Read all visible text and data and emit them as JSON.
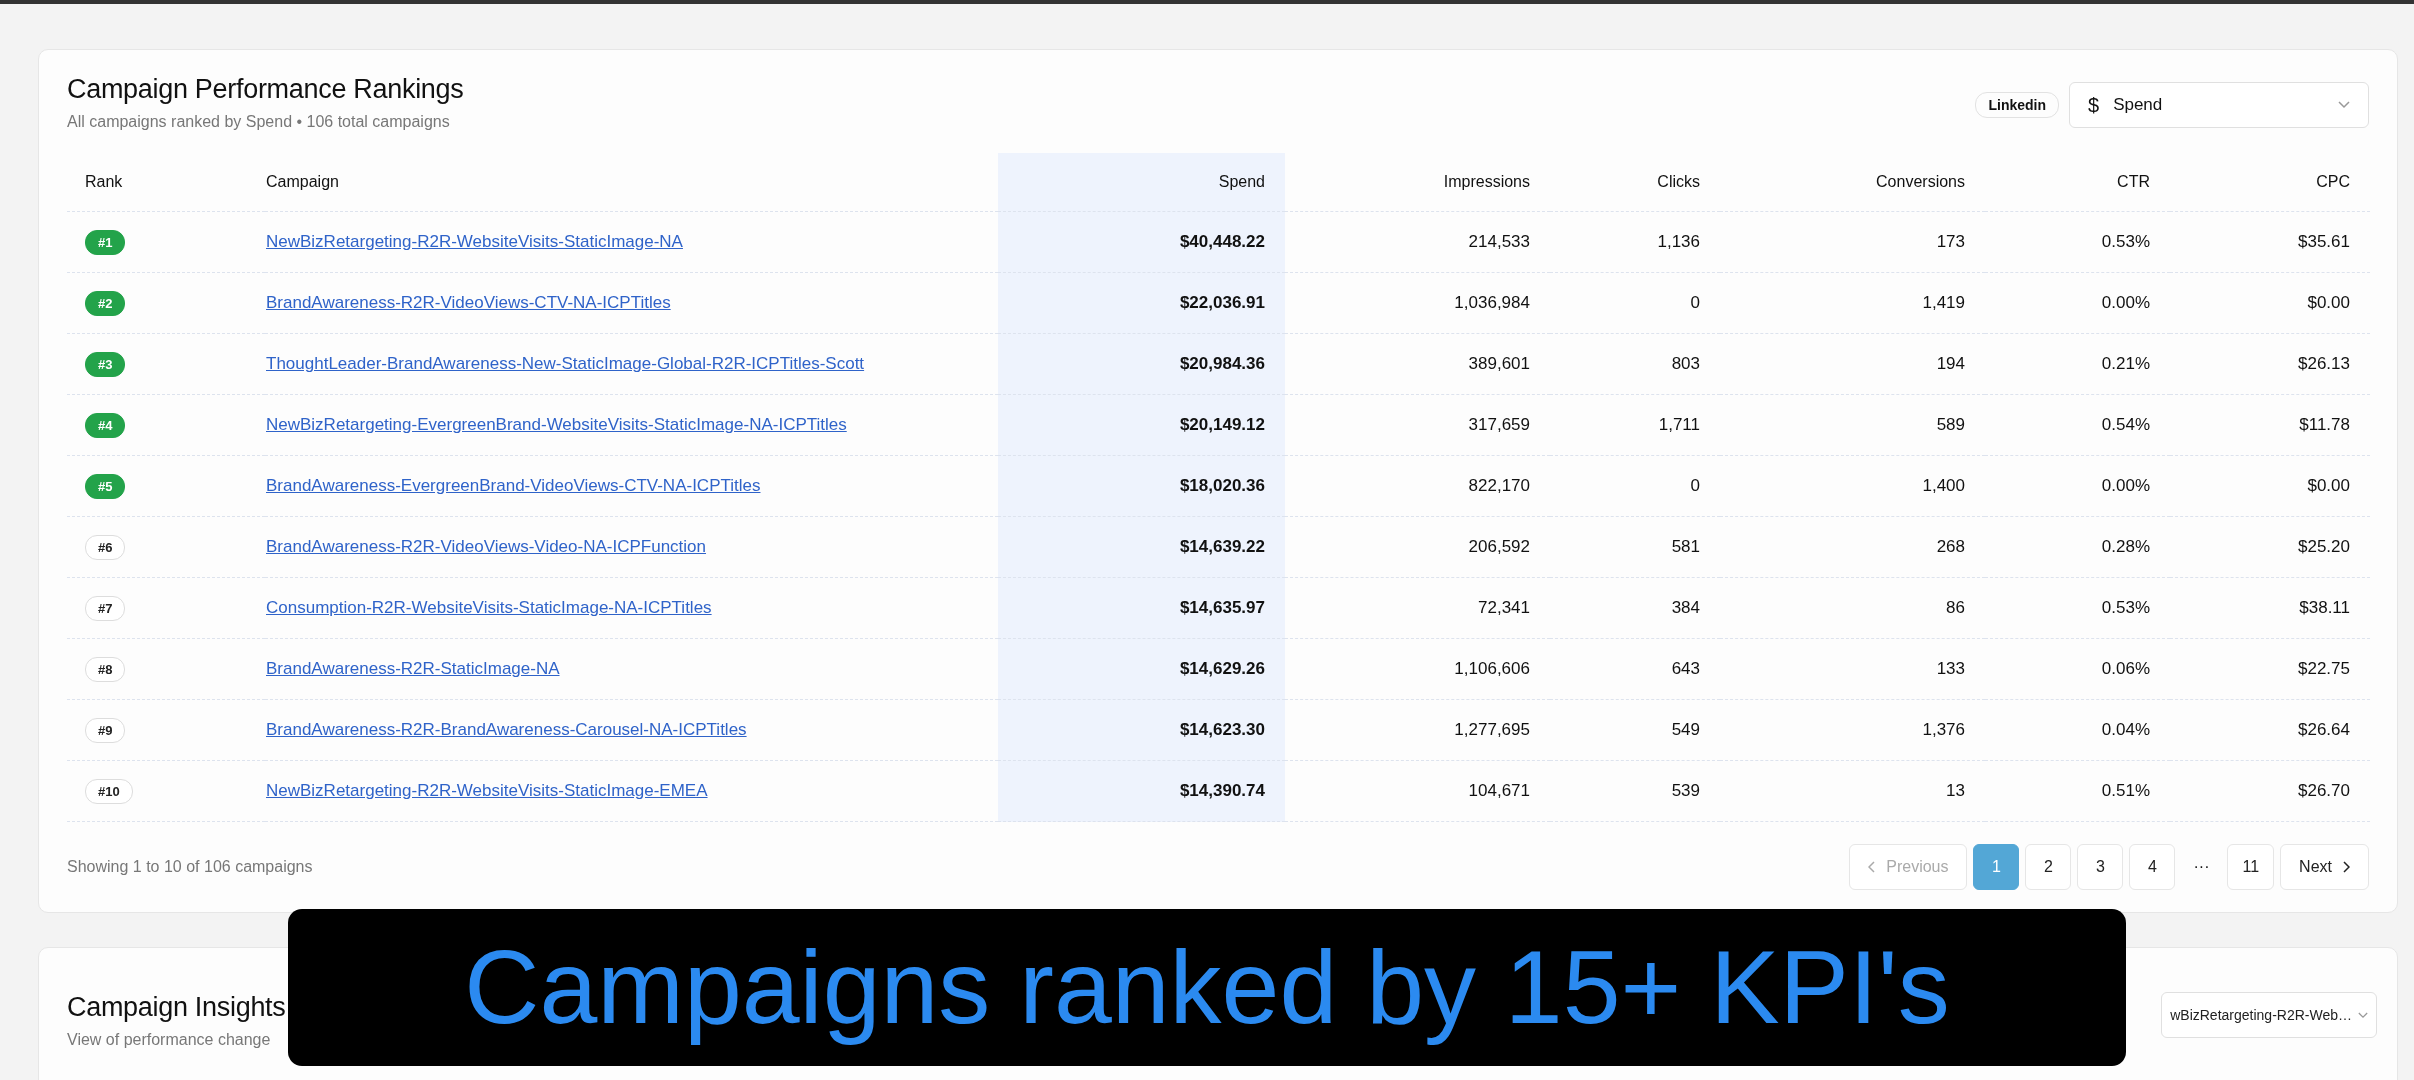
{
  "rankings": {
    "title": "Campaign Performance Rankings",
    "subtitle": "All campaigns ranked by Spend • 106 total campaigns",
    "platform_badge": "Linkedin",
    "metric_select": {
      "icon": "$",
      "value": "Spend"
    },
    "columns": [
      "Rank",
      "Campaign",
      "Spend",
      "Impressions",
      "Clicks",
      "Conversions",
      "CTR",
      "CPC"
    ],
    "rows": [
      {
        "rank": "#1",
        "top": true,
        "campaign": "NewBizRetargeting-R2R-WebsiteVisits-StaticImage-NA",
        "spend": "$40,448.22",
        "impressions": "214,533",
        "clicks": "1,136",
        "conversions": "173",
        "ctr": "0.53%",
        "cpc": "$35.61"
      },
      {
        "rank": "#2",
        "top": true,
        "campaign": "BrandAwareness-R2R-VideoViews-CTV-NA-ICPTitles",
        "spend": "$22,036.91",
        "impressions": "1,036,984",
        "clicks": "0",
        "conversions": "1,419",
        "ctr": "0.00%",
        "cpc": "$0.00"
      },
      {
        "rank": "#3",
        "top": true,
        "campaign": "ThoughtLeader-BrandAwareness-New-StaticImage-Global-R2R-ICPTitles-Scott",
        "spend": "$20,984.36",
        "impressions": "389,601",
        "clicks": "803",
        "conversions": "194",
        "ctr": "0.21%",
        "cpc": "$26.13"
      },
      {
        "rank": "#4",
        "top": true,
        "campaign": "NewBizRetargeting-EvergreenBrand-WebsiteVisits-StaticImage-NA-ICPTitles",
        "spend": "$20,149.12",
        "impressions": "317,659",
        "clicks": "1,711",
        "conversions": "589",
        "ctr": "0.54%",
        "cpc": "$11.78"
      },
      {
        "rank": "#5",
        "top": true,
        "campaign": "BrandAwareness-EvergreenBrand-VideoViews-CTV-NA-ICPTitles",
        "spend": "$18,020.36",
        "impressions": "822,170",
        "clicks": "0",
        "conversions": "1,400",
        "ctr": "0.00%",
        "cpc": "$0.00"
      },
      {
        "rank": "#6",
        "top": false,
        "campaign": "BrandAwareness-R2R-VideoViews-Video-NA-ICPFunction",
        "spend": "$14,639.22",
        "impressions": "206,592",
        "clicks": "581",
        "conversions": "268",
        "ctr": "0.28%",
        "cpc": "$25.20"
      },
      {
        "rank": "#7",
        "top": false,
        "campaign": "Consumption-R2R-WebsiteVisits-StaticImage-NA-ICPTitles",
        "spend": "$14,635.97",
        "impressions": "72,341",
        "clicks": "384",
        "conversions": "86",
        "ctr": "0.53%",
        "cpc": "$38.11"
      },
      {
        "rank": "#8",
        "top": false,
        "campaign": "BrandAwareness-R2R-StaticImage-NA",
        "spend": "$14,629.26",
        "impressions": "1,106,606",
        "clicks": "643",
        "conversions": "133",
        "ctr": "0.06%",
        "cpc": "$22.75"
      },
      {
        "rank": "#9",
        "top": false,
        "campaign": "BrandAwareness-R2R-BrandAwareness-Carousel-NA-ICPTitles",
        "spend": "$14,623.30",
        "impressions": "1,277,695",
        "clicks": "549",
        "conversions": "1,376",
        "ctr": "0.04%",
        "cpc": "$26.64"
      },
      {
        "rank": "#10",
        "top": false,
        "campaign": "NewBizRetargeting-R2R-WebsiteVisits-StaticImage-EMEA",
        "spend": "$14,390.74",
        "impressions": "104,671",
        "clicks": "539",
        "conversions": "13",
        "ctr": "0.51%",
        "cpc": "$26.70"
      }
    ],
    "showing": "Showing 1 to 10 of 106 campaigns",
    "pagination": {
      "previous": {
        "label": "Previous",
        "disabled": true
      },
      "pages": [
        {
          "label": "1",
          "kind": "page",
          "selected": true
        },
        {
          "label": "2",
          "kind": "page",
          "selected": false
        },
        {
          "label": "3",
          "kind": "page",
          "selected": false
        },
        {
          "label": "4",
          "kind": "page",
          "selected": false
        },
        {
          "label": "···",
          "kind": "ellipsis"
        },
        {
          "label": "11",
          "kind": "page",
          "selected": false
        }
      ],
      "next": {
        "label": "Next",
        "disabled": false
      }
    }
  },
  "insights": {
    "title": "Campaign Insights",
    "subtitle": "View of performance change",
    "campaign_select": "wBizRetargeting-R2R-Web…"
  },
  "caption": "Campaigns ranked by 15+ KPI's"
}
